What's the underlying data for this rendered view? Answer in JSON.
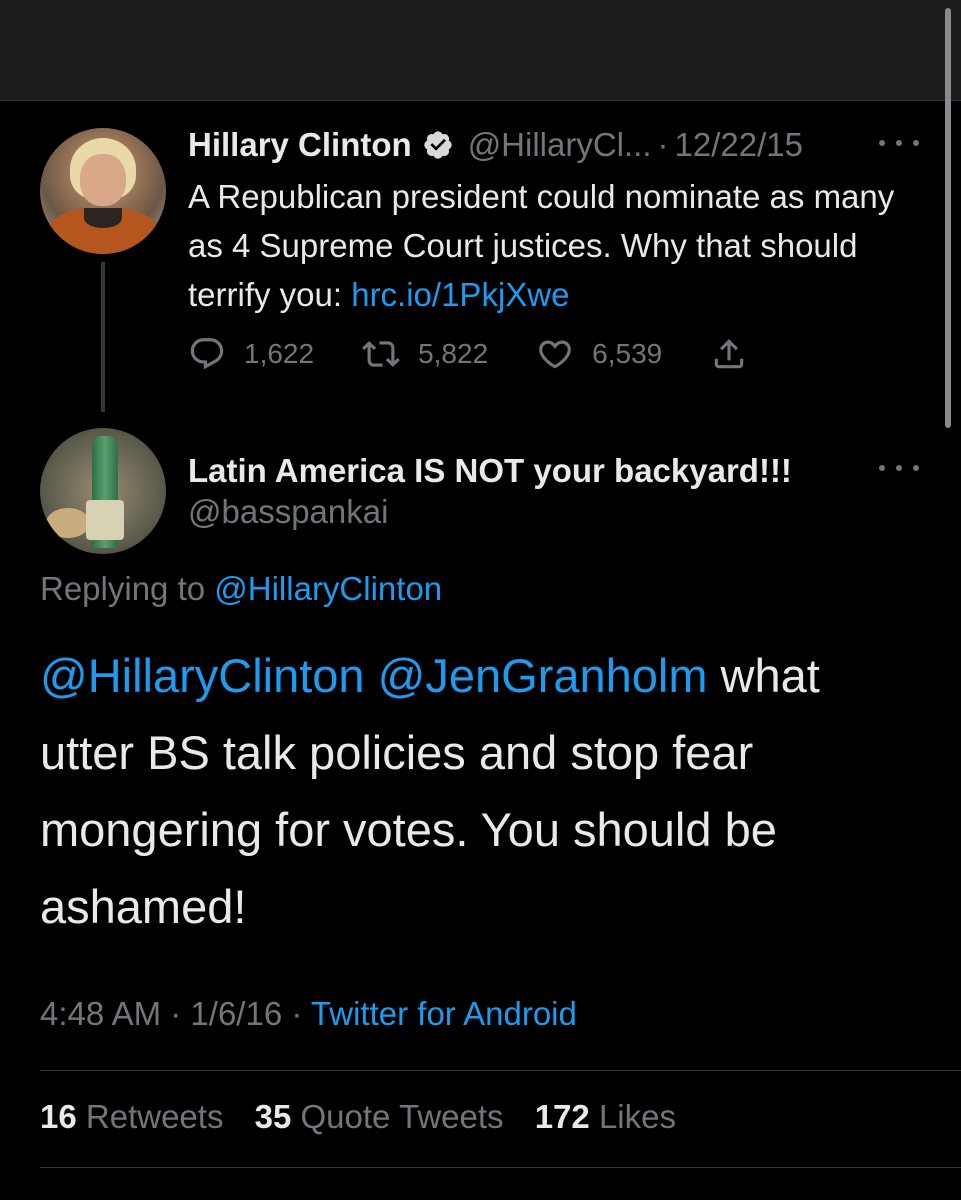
{
  "parent_tweet": {
    "display_name": "Hillary Clinton",
    "handle": "@HillaryCl...",
    "separator": "·",
    "date": "12/22/15",
    "text": "A Republican president could nominate as many as 4 Supreme Court justices. Why that should terrify you: ",
    "link": "hrc.io/1PkjXwe",
    "replies": "1,622",
    "retweets": "5,822",
    "likes": "6,539",
    "icons": [
      "verified-icon",
      "reply-icon",
      "retweet-icon",
      "like-icon",
      "share-icon",
      "more-icon"
    ]
  },
  "reply_tweet": {
    "display_name": "Latin America IS NOT your backyard!!!",
    "handle": "@basspankai",
    "replying_label": "Replying to ",
    "replying_to": "@HillaryClinton",
    "mention_1": "@HillaryClinton",
    "mention_2": "@JenGranholm",
    "text": " what utter BS talk policies and stop fear mongering for votes.  You should be ashamed!",
    "time": "4:48 AM",
    "date": "1/6/16",
    "separator": "·",
    "source": "Twitter for Android"
  },
  "stats": {
    "retweets_count": "16",
    "retweets_label": "Retweets",
    "quotes_count": "35",
    "quotes_label": "Quote Tweets",
    "likes_count": "172",
    "likes_label": "Likes"
  },
  "colors": {
    "background": "#000000",
    "text": "#e7e9ea",
    "muted": "#71767b",
    "link": "#1d9bf0",
    "verified_badge": "#d9d9d9"
  }
}
